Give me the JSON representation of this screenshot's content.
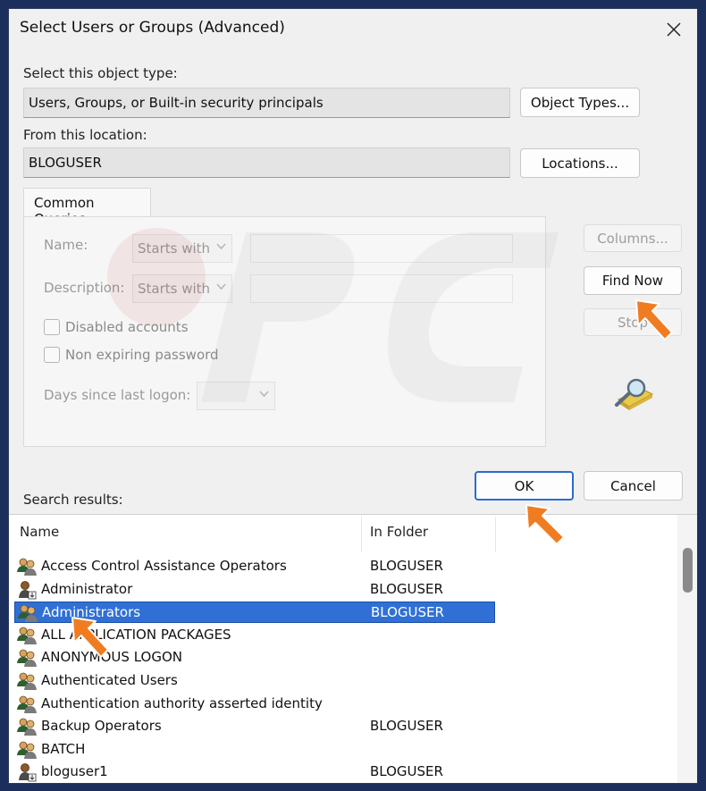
{
  "window": {
    "title": "Select Users or Groups (Advanced)"
  },
  "object_type": {
    "label": "Select this object type:",
    "value": "Users, Groups, or Built-in security principals",
    "button": "Object Types..."
  },
  "location": {
    "label": "From this location:",
    "value": "BLOGUSER",
    "button": "Locations..."
  },
  "queries": {
    "tab": "Common Queries",
    "name_label": "Name:",
    "name_mode": "Starts with",
    "description_label": "Description:",
    "description_mode": "Starts with",
    "disabled_accounts": "Disabled accounts",
    "non_expiring_password": "Non expiring password",
    "days_label": "Days since last logon:"
  },
  "side_buttons": {
    "columns": "Columns...",
    "find_now": "Find Now",
    "stop": "Stop"
  },
  "actions": {
    "ok": "OK",
    "cancel": "Cancel"
  },
  "results": {
    "label": "Search results:",
    "columns": [
      "Name",
      "In Folder"
    ],
    "rows": [
      {
        "name": "Access Control Assistance Operators",
        "folder": "BLOGUSER",
        "icon": "group-icon"
      },
      {
        "name": "Administrator",
        "folder": "BLOGUSER",
        "icon": "user-icon"
      },
      {
        "name": "Administrators",
        "folder": "BLOGUSER",
        "icon": "group-icon",
        "selected": true
      },
      {
        "name": "ALL APPLICATION PACKAGES",
        "folder": "",
        "icon": "group-icon"
      },
      {
        "name": "ANONYMOUS LOGON",
        "folder": "",
        "icon": "group-icon"
      },
      {
        "name": "Authenticated Users",
        "folder": "",
        "icon": "group-icon"
      },
      {
        "name": "Authentication authority asserted identity",
        "folder": "",
        "icon": "group-icon"
      },
      {
        "name": "Backup Operators",
        "folder": "BLOGUSER",
        "icon": "group-icon"
      },
      {
        "name": "BATCH",
        "folder": "",
        "icon": "group-icon"
      },
      {
        "name": "bloguser1",
        "folder": "BLOGUSER",
        "icon": "user-icon"
      }
    ]
  },
  "colors": {
    "selection": "#3070d6",
    "arrow": "#f07c22",
    "ok_border": "#2a6bd1"
  }
}
